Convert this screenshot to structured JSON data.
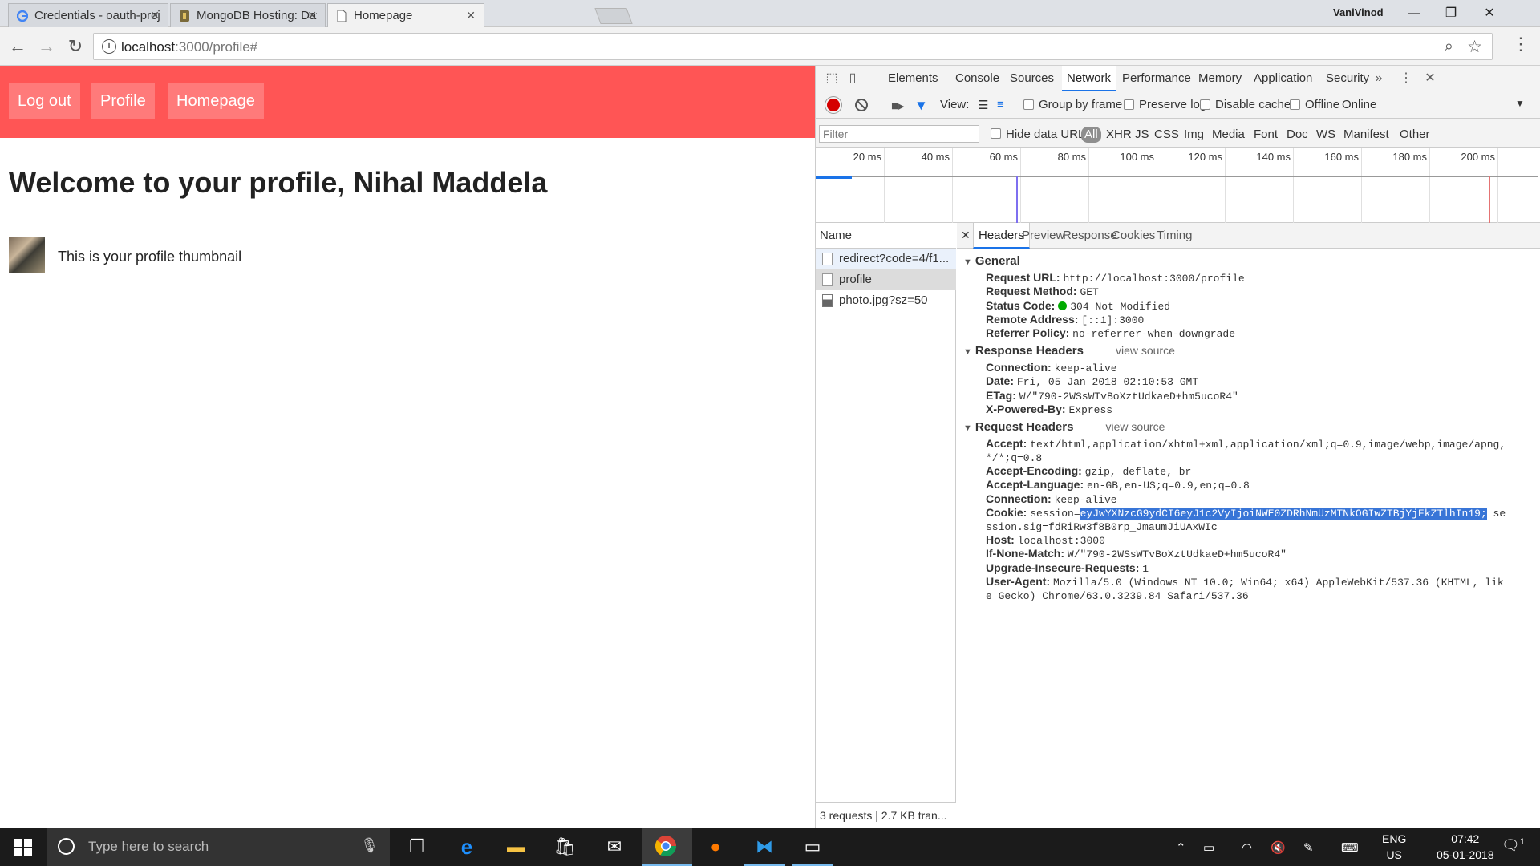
{
  "browser": {
    "tabs": [
      {
        "title": "Credentials - oauth-proje",
        "favicon": "google-icon"
      },
      {
        "title": "MongoDB Hosting: Datal",
        "favicon": "mlab-icon"
      },
      {
        "title": "Homepage",
        "favicon": "page-icon"
      }
    ],
    "profile_name": "VaniVinod",
    "url_host": "localhost",
    "url_path": ":3000/profile#"
  },
  "page": {
    "nav": [
      "Log out",
      "Profile",
      "Homepage"
    ],
    "heading": "Welcome to your profile, Nihal Maddela",
    "thumbnail_text": "This is your profile thumbnail",
    "accent": "#ff5555"
  },
  "devtools": {
    "tabs": [
      "Elements",
      "Console",
      "Sources",
      "Network",
      "Performance",
      "Memory",
      "Application",
      "Security"
    ],
    "active_tab": "Network",
    "view_label": "View:",
    "options": [
      "Group by frame",
      "Preserve log",
      "Disable cache",
      "Offline",
      "Online"
    ],
    "filter_placeholder": "Filter",
    "hide_data_urls": "Hide data URLs",
    "types": [
      "All",
      "XHR",
      "JS",
      "CSS",
      "Img",
      "Media",
      "Font",
      "Doc",
      "WS",
      "Manifest",
      "Other"
    ],
    "timeline_labels": [
      "20 ms",
      "40 ms",
      "60 ms",
      "80 ms",
      "100 ms",
      "120 ms",
      "140 ms",
      "160 ms",
      "180 ms",
      "200 ms"
    ],
    "name_header": "Name",
    "requests": [
      "redirect?code=4/f1...",
      "profile",
      "photo.jpg?sz=50"
    ],
    "summary": "3 requests | 2.7 KB tran...",
    "detail_tabs": [
      "Headers",
      "Preview",
      "Response",
      "Cookies",
      "Timing"
    ],
    "general": {
      "title": "General",
      "request_url_k": "Request URL:",
      "request_url_v": "http://localhost:3000/profile",
      "method_k": "Request Method:",
      "method_v": "GET",
      "status_k": "Status Code:",
      "status_v": "304 Not Modified",
      "remote_k": "Remote Address:",
      "remote_v": "[::1]:3000",
      "referrer_k": "Referrer Policy:",
      "referrer_v": "no-referrer-when-downgrade"
    },
    "response_headers": {
      "title": "Response Headers",
      "view_source": "view source",
      "connection_k": "Connection:",
      "connection_v": "keep-alive",
      "date_k": "Date:",
      "date_v": "Fri, 05 Jan 2018 02:10:53 GMT",
      "etag_k": "ETag:",
      "etag_v": "W/\"790-2WSsWTvBoXztUdkaeD+hm5ucoR4\"",
      "xpb_k": "X-Powered-By:",
      "xpb_v": "Express"
    },
    "request_headers": {
      "title": "Request Headers",
      "view_source": "view source",
      "accept_k": "Accept:",
      "accept_v": "text/html,application/xhtml+xml,application/xml;q=0.9,image/webp,image/apng,",
      "accept_v2": "*/*;q=0.8",
      "enc_k": "Accept-Encoding:",
      "enc_v": "gzip, deflate, br",
      "lang_k": "Accept-Language:",
      "lang_v": "en-GB,en-US;q=0.9,en;q=0.8",
      "conn_k": "Connection:",
      "conn_v": "keep-alive",
      "cookie_k": "Cookie:",
      "cookie_pre": "session=",
      "cookie_sel": "eyJwYXNzcG9ydCI6eyJ1c2VyIjoiNWE0ZDRhNmUzMTNkOGIwZTBjYjFkZTlhIn19;",
      "cookie_post": " se",
      "cookie_v2": "ssion.sig=fdRiRw3f8B0rp_JmaumJiUAxWIc",
      "host_k": "Host:",
      "host_v": "localhost:3000",
      "inm_k": "If-None-Match:",
      "inm_v": "W/\"790-2WSsWTvBoXztUdkaeD+hm5ucoR4\"",
      "uir_k": "Upgrade-Insecure-Requests:",
      "uir_v": "1",
      "ua_k": "User-Agent:",
      "ua_v": "Mozilla/5.0 (Windows NT 10.0; Win64; x64) AppleWebKit/537.36 (KHTML, lik",
      "ua_v2": "e Gecko) Chrome/63.0.3239.84 Safari/537.36"
    }
  },
  "taskbar": {
    "search_placeholder": "Type here to search",
    "lang_top": "ENG",
    "lang_bottom": "US",
    "time": "07:42",
    "date": "05-01-2018",
    "notifications": "1"
  }
}
